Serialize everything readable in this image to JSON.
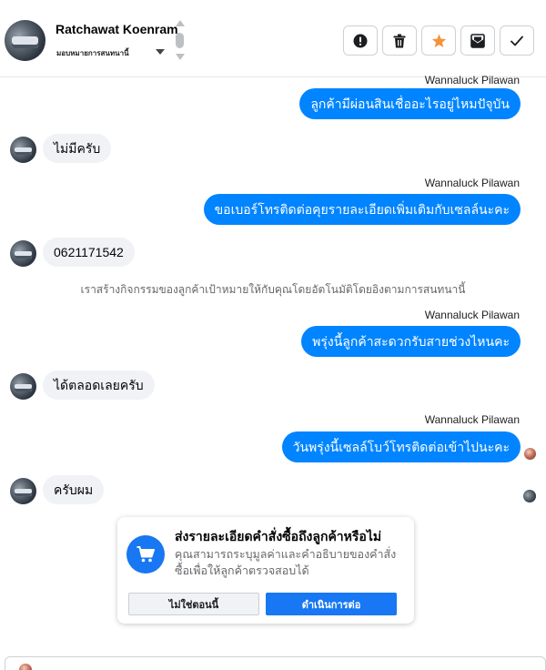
{
  "header": {
    "contact_name": "Ratchawat Koenram",
    "assign_label": "มอบหมายการสนทนานี้",
    "actions": [
      {
        "name": "report-icon",
        "label": "!"
      },
      {
        "name": "trash-icon",
        "label": "delete"
      },
      {
        "name": "star-icon",
        "label": "star"
      },
      {
        "name": "mark-unread-icon",
        "label": "envelope"
      },
      {
        "name": "check-icon",
        "label": "done"
      }
    ],
    "star_color": "#f7923a"
  },
  "messages": {
    "m1_sender": "Wannaluck Pilawan",
    "m1_text": "ลูกค้ามีผ่อนสินเชื่ออะไรอยู่ไหมปัจุบัน",
    "m2_text": "ไม่มีครับ",
    "m3_sender": "Wannaluck Pilawan",
    "m3_text": "ขอเบอร์โทรติดต่อคุยรายละเอียดเพิ่มเติมกับเซลล์นะคะ",
    "m4_text": "0621171542",
    "system_note": "เราสร้างกิจกรรมของลูกค้าเป้าหมายให้กับคุณโดยอัตโนมัติโดยอิงตามการสนทนานี้",
    "m5_sender": "Wannaluck Pilawan",
    "m5_text": "พรุ่งนี้ลูกค้าสะดวกรับสายช่วงไหนคะ",
    "m6_text": "ได้ตลอดเลยครับ",
    "m7_sender": "Wannaluck Pilawan",
    "m7_text": "วันพรุ่งนี้เซลล์โบว์โทรติดต่อเข้าไปนะคะ",
    "m8_text": "ครับผม"
  },
  "card": {
    "title": "ส่งรายละเอียดคำสั่งซื้อถึงลูกค้าหรือไม่",
    "description": "คุณสามารถระบุมูลค่าและคำอธิบายของคำสั่งซื้อเพื่อให้ลูกค้าตรวจสอบได้",
    "secondary_label": "ไม่ใช่ตอนนี้",
    "primary_label": "ดำเนินการต่อ",
    "icon": "shopping-cart-icon"
  },
  "colors": {
    "outgoing_bubble": "#0084ff",
    "incoming_bubble": "#f0f2f5",
    "primary_button": "#1877f2"
  }
}
